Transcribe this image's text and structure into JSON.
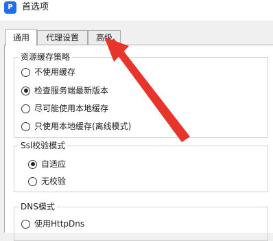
{
  "window": {
    "title": "首选项",
    "app_icon_text": "P"
  },
  "tabs": [
    {
      "label": "通用",
      "active": true
    },
    {
      "label": "代理设置",
      "active": false
    },
    {
      "label": "高级",
      "active": false
    }
  ],
  "cache_group": {
    "title": "资源缓存策略",
    "options": [
      {
        "label": "不使用缓存",
        "checked": false
      },
      {
        "label": "检查服务端最新版本",
        "checked": true
      },
      {
        "label": "尽可能使用本地缓存",
        "checked": false
      },
      {
        "label": "只使用本地缓存(离线模式)",
        "checked": false
      }
    ]
  },
  "ssl_group": {
    "title": "Ssl校验模式",
    "options": [
      {
        "label": "自适应",
        "checked": true
      },
      {
        "label": "无校验",
        "checked": false
      }
    ]
  },
  "dns_group": {
    "title": "DNS模式",
    "options": [
      {
        "label": "使用HttpDns",
        "checked": false
      }
    ]
  },
  "colors": {
    "arrow": "#e8352c",
    "app_icon": "#1e6ff0"
  }
}
